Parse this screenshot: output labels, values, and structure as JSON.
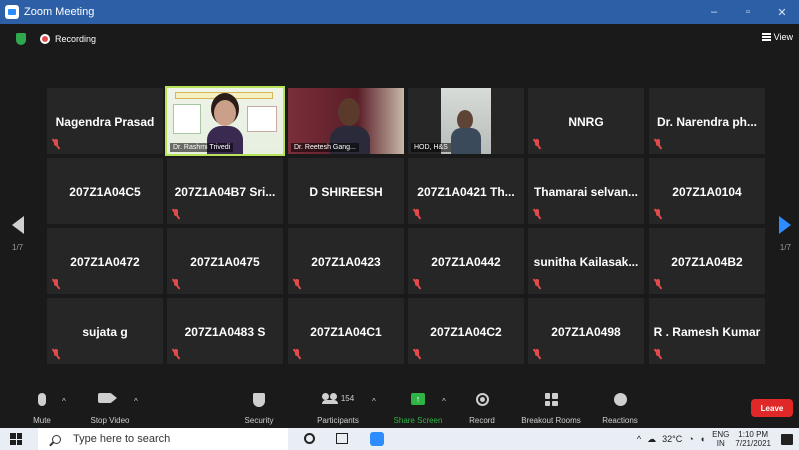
{
  "window": {
    "title": "Zoom Meeting",
    "controls": [
      "–",
      "▫",
      "✕"
    ]
  },
  "topbar": {
    "recording_label": "Recording",
    "view_label": "View"
  },
  "gallery": {
    "page_left": "1/7",
    "page_right": "1/7",
    "tiles": [
      {
        "name": "Nagendra Prasad",
        "video": false
      },
      {
        "name": "Dr. Rashmi Trivedi",
        "video": true
      },
      {
        "name": "Dr. Reetesh Gang...",
        "video": true
      },
      {
        "name": "HOD, H&S",
        "video": true
      },
      {
        "name": "NNRG",
        "video": false
      },
      {
        "name": "Dr. Narendra ph...",
        "video": false
      },
      {
        "name": "207Z1A04C5",
        "video": false
      },
      {
        "name": "207Z1A04B7  Sri...",
        "video": false
      },
      {
        "name": "D SHIREESH",
        "video": false
      },
      {
        "name": "207Z1A0421  Th...",
        "video": false
      },
      {
        "name": "Thamarai  selvan...",
        "video": false
      },
      {
        "name": "207Z1A0104",
        "video": false
      },
      {
        "name": "207Z1A0472",
        "video": false
      },
      {
        "name": "207Z1A0475",
        "video": false
      },
      {
        "name": "207Z1A0423",
        "video": false
      },
      {
        "name": "207Z1A0442",
        "video": false
      },
      {
        "name": "sunitha  Kailasak...",
        "video": false
      },
      {
        "name": "207Z1A04B2",
        "video": false
      },
      {
        "name": "sujata g",
        "video": false
      },
      {
        "name": "207Z1A0483 S",
        "video": false
      },
      {
        "name": "207Z1A04C1",
        "video": false
      },
      {
        "name": "207Z1A04C2",
        "video": false
      },
      {
        "name": "207Z1A0498",
        "video": false
      },
      {
        "name": "R . Ramesh Kumar",
        "video": false
      }
    ]
  },
  "toolbar": {
    "mute": "Mute",
    "stop_video": "Stop Video",
    "security": "Security",
    "participants": "Participants",
    "participant_count": "154",
    "share_screen": "Share Screen",
    "record": "Record",
    "breakout_rooms": "Breakout Rooms",
    "reactions": "Reactions",
    "leave": "Leave",
    "caret": "^"
  },
  "taskbar": {
    "search_placeholder": "Type here to search",
    "temperature": "32°C",
    "language_top": "ENG",
    "language_bottom": "IN",
    "time": "1:10 PM",
    "date": "7/21/2021"
  },
  "colors": {
    "titlebar": "#2c5fa6",
    "accent_blue": "#2d8cff",
    "share_green": "#2fb344",
    "leave_red": "#e02828",
    "muted_red": "#e14b4b",
    "active_speaker": "#b6e35a"
  }
}
